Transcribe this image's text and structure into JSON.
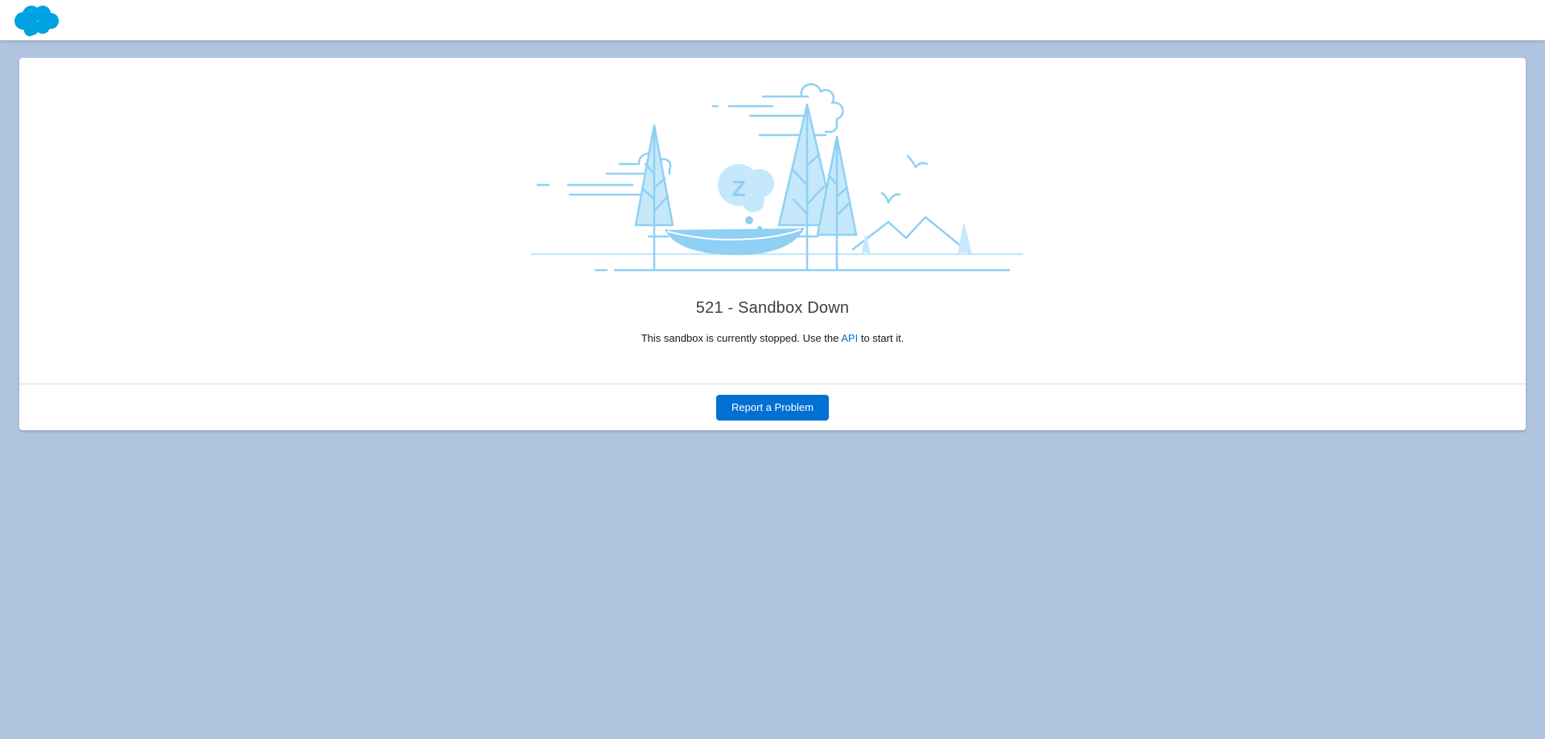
{
  "header": {
    "logo_icon": "salesforce-cloud-logo",
    "brand_color": "#00a1e0"
  },
  "illustration": {
    "icon": "sleeping-hammock-illustration",
    "snooze_letter": "Z",
    "stroke_color": "#8fd0f4",
    "fill_color": "#c6e8fb"
  },
  "error": {
    "title": "521 - Sandbox Down",
    "message_before": "This sandbox is currently stopped. Use the ",
    "link_text": "API",
    "message_after": " to start it."
  },
  "footer": {
    "report_button_label": "Report a Problem",
    "button_color": "#0070d2"
  },
  "colors": {
    "background": "#b0c4df",
    "card": "#ffffff",
    "link": "#0070d2"
  }
}
